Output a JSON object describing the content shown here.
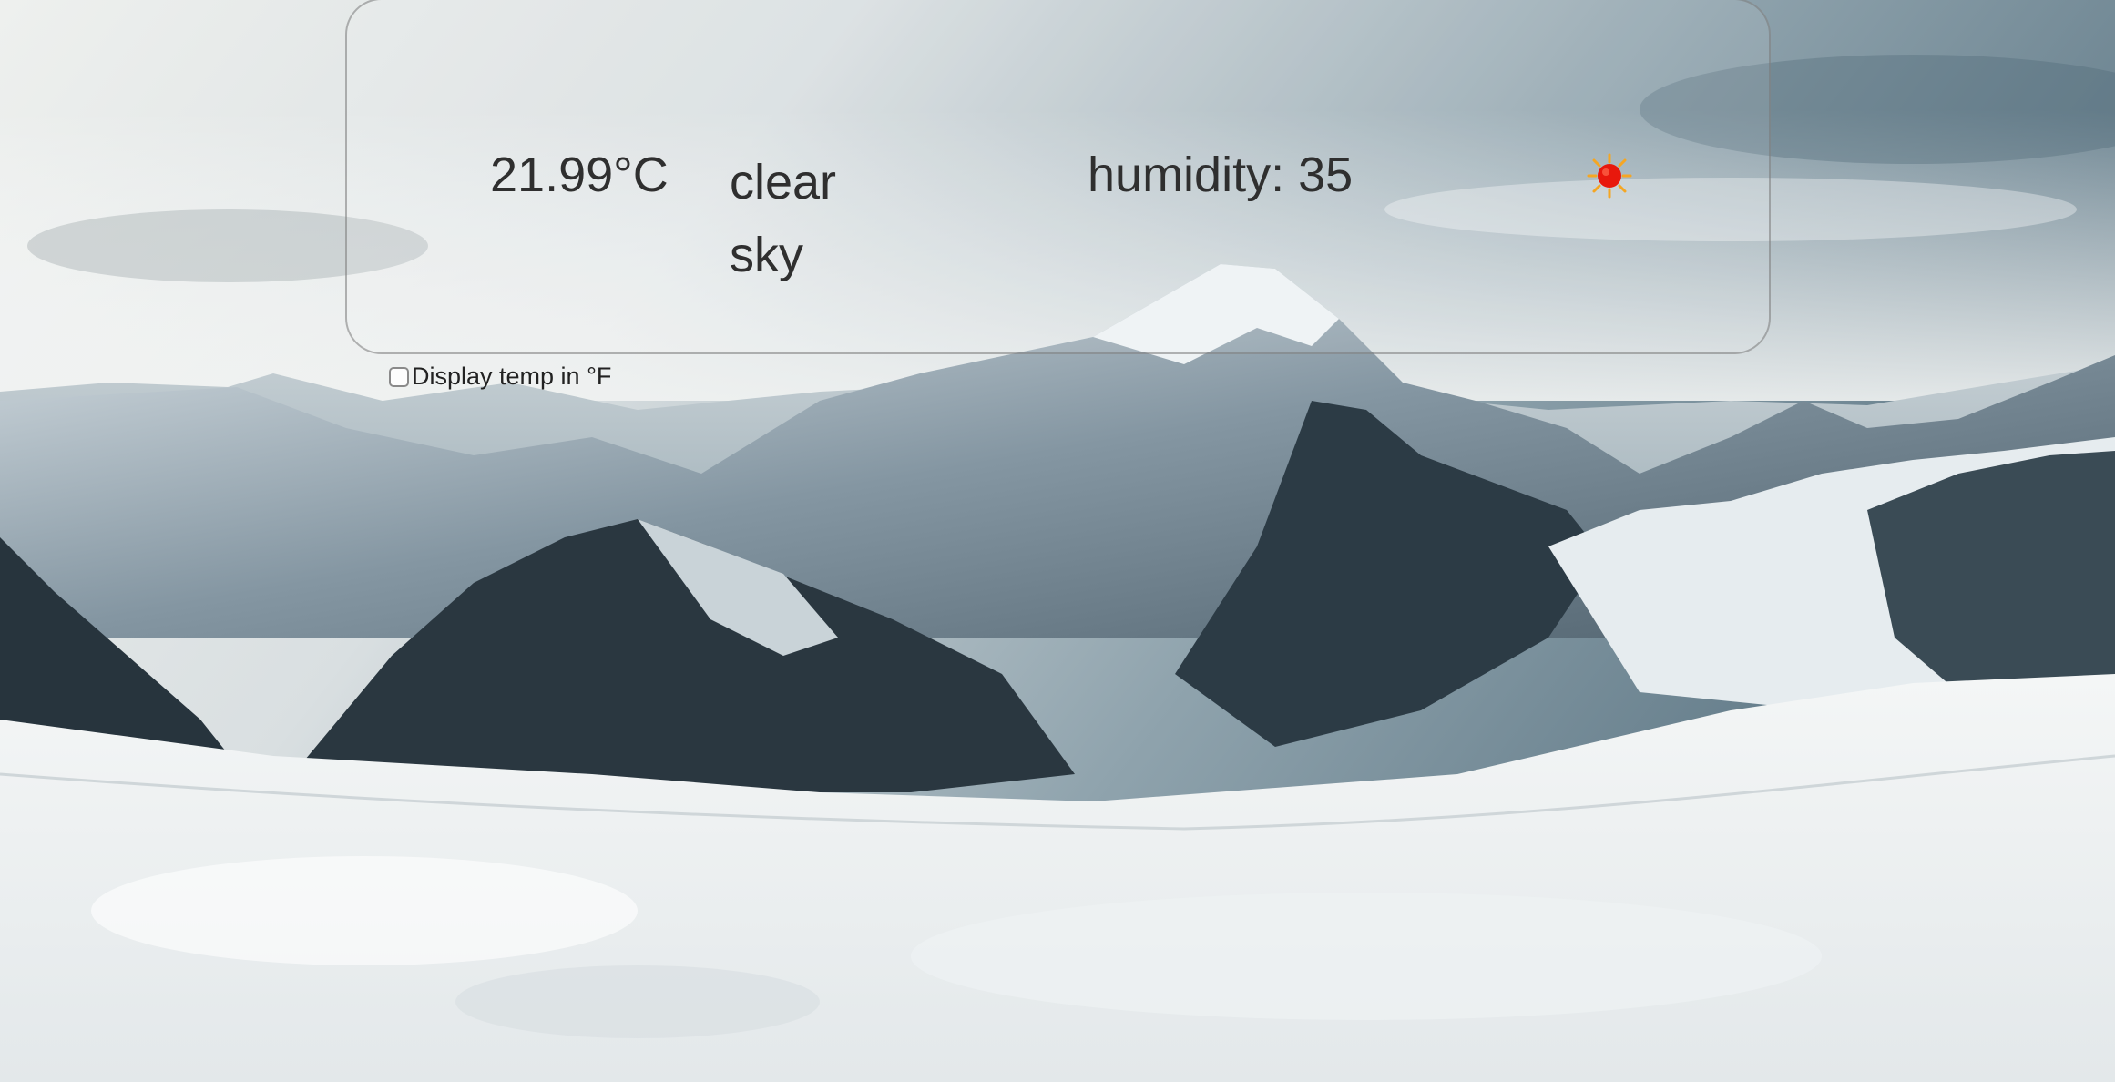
{
  "weather": {
    "temperature": "21.99°C",
    "description": "clear sky",
    "humidity": "humidity: 35",
    "icon": "sun-icon"
  },
  "settings": {
    "fahrenheit_label": "Display temp in °F",
    "fahrenheit_checked": false
  },
  "colors": {
    "text": "#2f2f2f",
    "sun": "#e8180c",
    "sun_rays": "#f5a623"
  }
}
